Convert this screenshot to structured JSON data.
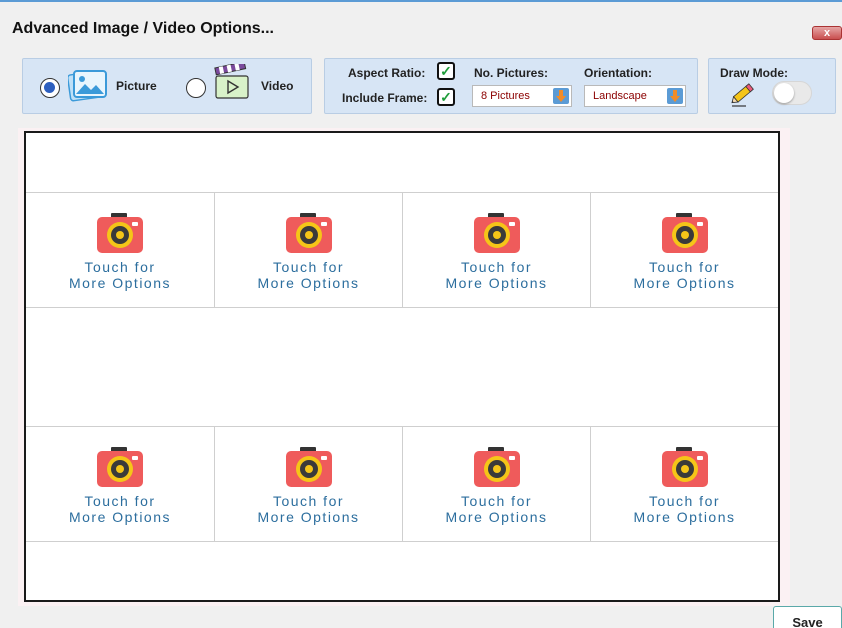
{
  "window": {
    "title": "Advanced Image / Video Options...",
    "close_label": "x"
  },
  "media_type": {
    "picture_label": "Picture",
    "video_label": "Video",
    "selected": "Picture"
  },
  "options": {
    "aspect_ratio_label": "Aspect Ratio:",
    "aspect_ratio_checked": true,
    "include_frame_label": "Include Frame:",
    "include_frame_checked": true,
    "check_glyph": "✓",
    "no_pictures_label": "No. Pictures:",
    "no_pictures_value": "8 Pictures",
    "orientation_label": "Orientation:",
    "orientation_value": "Landscape"
  },
  "draw_mode": {
    "label": "Draw Mode:",
    "enabled": false
  },
  "grid": {
    "cells": [
      {
        "line1": "Touch for",
        "line2": "More Options"
      },
      {
        "line1": "Touch for",
        "line2": "More Options"
      },
      {
        "line1": "Touch for",
        "line2": "More Options"
      },
      {
        "line1": "Touch for",
        "line2": "More Options"
      },
      {
        "line1": "Touch for",
        "line2": "More Options"
      },
      {
        "line1": "Touch for",
        "line2": "More Options"
      },
      {
        "line1": "Touch for",
        "line2": "More Options"
      },
      {
        "line1": "Touch for",
        "line2": "More Options"
      }
    ]
  },
  "footer": {
    "save_label": "Save"
  },
  "colors": {
    "panel_bg": "#d7e5f5",
    "camera_red": "#ef5b5b",
    "lens_yellow": "#f5c518",
    "cell_text": "#2c6e9e",
    "select_text": "#8b0000",
    "check_green": "#1f9d3a"
  }
}
